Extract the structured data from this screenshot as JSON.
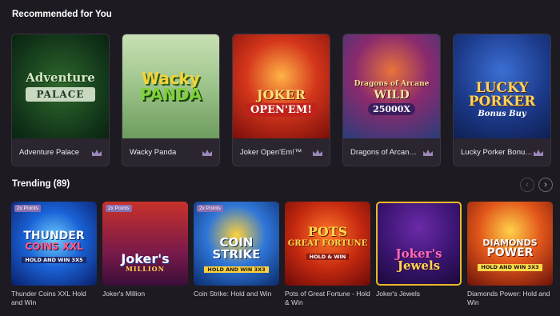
{
  "recommended": {
    "title": "Recommended for You",
    "games": [
      {
        "name": "Adventure Palace",
        "art_line1": "Adventure",
        "art_line2": "PALACE"
      },
      {
        "name": "Wacky Panda",
        "art_line1": "Wacky",
        "art_line2": "PANDA"
      },
      {
        "name": "Joker Open'Em!™",
        "art_line1": "JOKER",
        "art_line2": "OPEN'EM!"
      },
      {
        "name": "Dragons of Arcan…",
        "art_line1": "Dragons of Arcane",
        "art_line2": "WILD",
        "art_line3": "25000X"
      },
      {
        "name": "Lucky Porker Bonu…",
        "art_line1": "LUCKY",
        "art_line2": "PORKER",
        "art_line3": "Bonus Buy"
      }
    ]
  },
  "trending": {
    "title": "Trending (89)",
    "prev_icon": "chevron-left-icon",
    "next_icon": "chevron-right-icon",
    "games": [
      {
        "name": "Thunder Coins XXL Hold and Win",
        "badge": "2x Points",
        "art_line1": "THUNDER",
        "art_line2": "COINS XXL",
        "art_line3": "HOLD AND WIN 3X5"
      },
      {
        "name": "Joker's Million",
        "badge": "2x Points",
        "art_line1": "Joker's",
        "art_line2": "MILLION"
      },
      {
        "name": "Coin Strike: Hold and Win",
        "badge": "2x Points",
        "art_line1": "COIN",
        "art_line2": "STRIKE",
        "art_line3": "HOLD AND WIN 3X3"
      },
      {
        "name": "Pots of Great Fortune - Hold & Win",
        "art_line1": "POTS",
        "art_line2": "GREAT FORTUNE",
        "art_line3": "HOLD & WIN"
      },
      {
        "name": "Joker's Jewels",
        "art_line1": "Joker's",
        "art_line2": "Jewels"
      },
      {
        "name": "Diamonds Power: Hold and Win",
        "art_line1": "DIAMONDS",
        "art_line2": "POWER",
        "art_line3": "HOLD AND WIN 3X3"
      }
    ]
  },
  "colors": {
    "background": "#1d1a21",
    "card": "#2a252e",
    "crown": "#9b87b8",
    "badge": "#8a6fb0"
  }
}
